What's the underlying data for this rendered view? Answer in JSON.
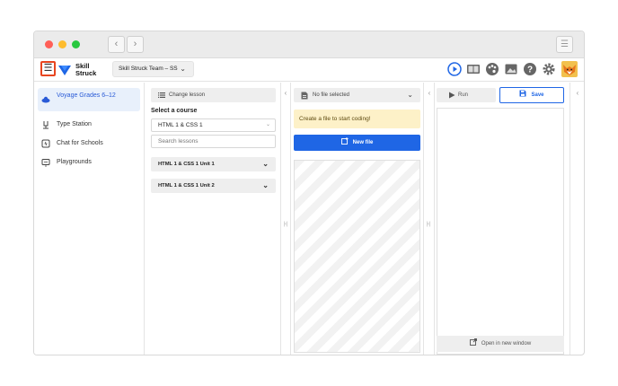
{
  "window": {
    "nav_back": "‹",
    "nav_forward": "›",
    "menu_glyph": "☰"
  },
  "header": {
    "menu_glyph": "☰",
    "logo_line1": "Skill",
    "logo_line2": "Struck",
    "team_label": "Skill Struck Team – SS",
    "chevron": "⌄",
    "icons": [
      "play-circle-icon",
      "book-icon",
      "palette-icon",
      "image-icon",
      "help-icon",
      "gear-icon",
      "avatar-fox"
    ]
  },
  "sidebar": {
    "items": [
      {
        "label": "Voyage Grades 6–12",
        "icon": "voyage-icon",
        "active": true
      },
      {
        "label": "Type Station",
        "icon": "keyboard-icon",
        "active": false
      },
      {
        "label": "Chat for Schools",
        "icon": "chat-icon",
        "active": false
      },
      {
        "label": "Playgrounds",
        "icon": "playground-icon",
        "active": false
      }
    ]
  },
  "lessons": {
    "change_lesson": "Change lesson",
    "select_course_label": "Select a course",
    "selected_course": "HTML 1 & CSS 1",
    "search_placeholder": "Search lessons",
    "units": [
      "HTML 1 & CSS 1 Unit 1",
      "HTML 1 & CSS 1 Unit 2"
    ],
    "collapse_glyph": "‹"
  },
  "files": {
    "selector_label": "No file selected",
    "notice": "Create a file to start coding!",
    "new_file_label": "New file",
    "collapse_glyph": "‹",
    "handle_glyph": "|‹|"
  },
  "preview": {
    "run_label": "Run",
    "save_label": "Save",
    "open_window_label": "Open in new window",
    "collapse_glyph": "‹",
    "handle_glyph": "|‹|"
  },
  "colors": {
    "primary_blue": "#1f66e5",
    "notice_bg": "#fdf1c8",
    "highlight_red": "#e8451f",
    "active_bg": "#e8f0fb"
  }
}
